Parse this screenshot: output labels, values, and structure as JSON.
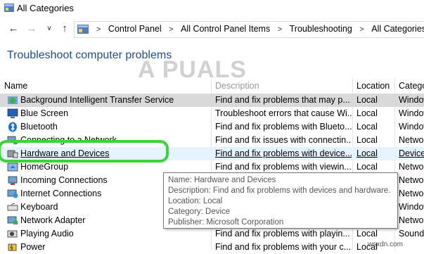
{
  "window": {
    "title": "All Categories"
  },
  "breadcrumb": [
    "Control Panel",
    "All Control Panel Items",
    "Troubleshooting",
    "All Categories"
  ],
  "page": {
    "heading": "Troubleshoot computer problems"
  },
  "watermark": "A  PUALS",
  "columns": {
    "name": "Name",
    "description": "Description",
    "location": "Location",
    "category": "Category"
  },
  "rows": [
    {
      "name": "Background Intelligent Transfer Service",
      "description": "Find and fix problems that may p...",
      "location": "Local",
      "category": "Windows",
      "icon": "bits-icon"
    },
    {
      "name": "Blue Screen",
      "description": "Troubleshoot errors that cause Wi...",
      "location": "Local",
      "category": "Windows",
      "icon": "blue-screen-icon"
    },
    {
      "name": "Bluetooth",
      "description": "Find and fix problems with Blueto...",
      "location": "Local",
      "category": "Windows",
      "icon": "bluetooth-icon"
    },
    {
      "name": "Connecting to a Network",
      "description": "Find and fix issues with connectin...",
      "location": "Local",
      "category": "Network",
      "icon": "network-icon"
    },
    {
      "name": "Hardware and Devices",
      "description": "Find and fix problems with device...",
      "location": "Local",
      "category": "Device",
      "icon": "hardware-icon"
    },
    {
      "name": "HomeGroup",
      "description": "Find and fix problems with viewin...",
      "location": "Local",
      "category": "Network",
      "icon": "homegroup-icon"
    },
    {
      "name": "Incoming Connections",
      "description": "",
      "location": "",
      "category": "Network",
      "icon": "incoming-icon"
    },
    {
      "name": "Internet Connections",
      "description": "",
      "location": "",
      "category": "Network",
      "icon": "internet-icon"
    },
    {
      "name": "Keyboard",
      "description": "",
      "location": "",
      "category": "Windows",
      "icon": "keyboard-icon"
    },
    {
      "name": "Network Adapter",
      "description": "",
      "location": "",
      "category": "Network",
      "icon": "adapter-icon"
    },
    {
      "name": "Playing Audio",
      "description": "Find and fix problems with playin...",
      "location": "Local",
      "category": "Sound",
      "icon": "audio-icon"
    },
    {
      "name": "Power",
      "description": "Find and fix problems with your c...",
      "location": "Local",
      "category": "System",
      "icon": "power-icon"
    }
  ],
  "tooltip": {
    "name": "Name: Hardware and Devices",
    "description": "Description: Find and fix problems with devices and hardware.",
    "location": "Location: Local",
    "category": "Category: Device",
    "publisher": "Publisher: Microsoft Corporation"
  },
  "brand": "wsxdn.com"
}
